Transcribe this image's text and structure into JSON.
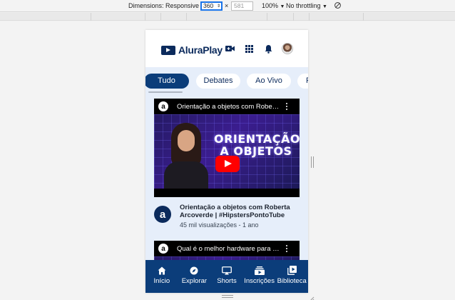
{
  "devtools": {
    "dimensions_label": "Dimensions: Responsive",
    "width_value": "360",
    "times": "×",
    "height_value": "581",
    "zoom": "100%",
    "throttling": "No throttling"
  },
  "app": {
    "logo_text": "AluraPlay",
    "chips": [
      "Tudo",
      "Debates",
      "Ao Vivo",
      "F"
    ],
    "videos": [
      {
        "thumb_title": "Orientação a objetos com Robert...",
        "thumb_big_title": "ORIENTAÇÃO A OBJETOS",
        "channel_initial": "a",
        "title": "Orientação a objetos com Roberta Arcoverde | #HipstersPontoTube",
        "stats": "45 mil visualizações - 1 ano"
      },
      {
        "thumb_title": "Qual é o melhor hardware para pr..."
      }
    ],
    "nav": [
      {
        "label": "Início",
        "icon": "home-icon"
      },
      {
        "label": "Explorar",
        "icon": "compass-icon"
      },
      {
        "label": "Shorts",
        "icon": "shorts-icon"
      },
      {
        "label": "Inscrições",
        "icon": "subscriptions-icon"
      },
      {
        "label": "Biblioteca",
        "icon": "library-icon"
      }
    ]
  },
  "colors": {
    "brand_dark": "#0b2a5c",
    "nav_bg": "#0b3d7a",
    "content_bg": "#e6eefa",
    "play_red": "#ff0000"
  }
}
